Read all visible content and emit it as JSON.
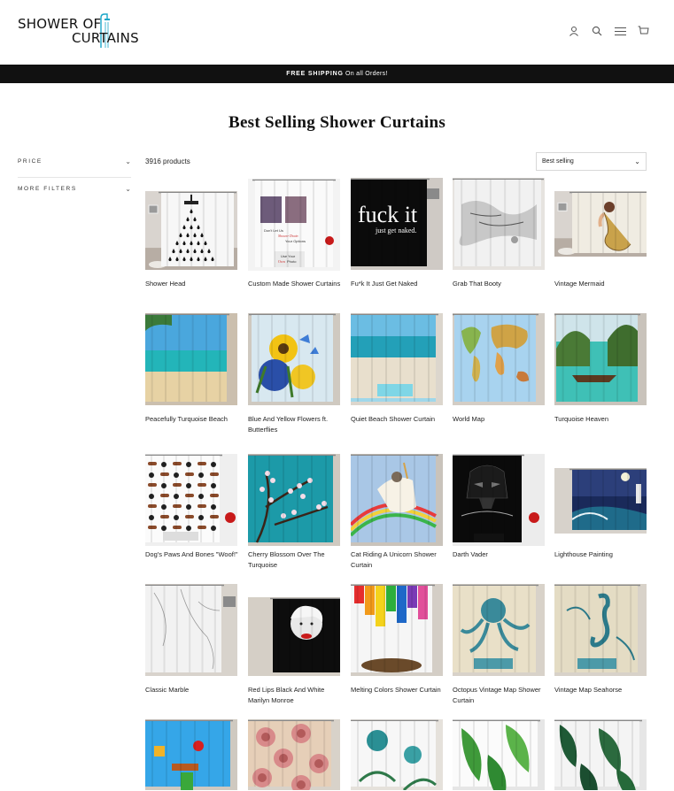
{
  "logo": {
    "line1": "SHOWER OF",
    "line2": "CURTAINS"
  },
  "header": {
    "icons": [
      "user-icon",
      "search-icon",
      "menu-icon",
      "cart-icon"
    ]
  },
  "announcement": {
    "bold": "FREE SHIPPING",
    "rest": " On all Orders!"
  },
  "page_title": "Best Selling Shower Curtains",
  "filters": [
    {
      "label": "PRICE"
    },
    {
      "label": "MORE FILTERS"
    }
  ],
  "product_count": "3916 products",
  "sort": {
    "selected": "Best selling"
  },
  "products": [
    {
      "title": "Shower Head"
    },
    {
      "title": "Custom Made Shower Curtains"
    },
    {
      "title": "Fu*k It Just Get Naked",
      "art_text1": "fuck it",
      "art_text2": "just get naked."
    },
    {
      "title": "Grab That Booty"
    },
    {
      "title": "Vintage Mermaid"
    },
    {
      "title": "Peacefully Turquoise Beach"
    },
    {
      "title": "Blue And Yellow Flowers ft. Butterflies"
    },
    {
      "title": "Quiet Beach Shower Curtain"
    },
    {
      "title": "World Map"
    },
    {
      "title": "Turquoise Heaven"
    },
    {
      "title": "Dog's Paws And Bones \"Woof!\""
    },
    {
      "title": "Cherry Blossom Over The Turquoise"
    },
    {
      "title": "Cat Riding A Unicorn Shower Curtain"
    },
    {
      "title": "Darth Vader"
    },
    {
      "title": "Lighthouse Painting"
    },
    {
      "title": "Classic Marble"
    },
    {
      "title": "Red Lips Black And White Marilyn Monroe"
    },
    {
      "title": "Melting Colors Shower Curtain"
    },
    {
      "title": "Octopus Vintage Map Shower Curtain"
    },
    {
      "title": "Vintage Map Seahorse"
    },
    {
      "title": ""
    },
    {
      "title": ""
    },
    {
      "title": ""
    },
    {
      "title": ""
    },
    {
      "title": ""
    }
  ],
  "custom_art": {
    "line1": "Don't Let Us",
    "line2": "Shower Drain",
    "line3": "Your Options",
    "line4": "Use Your",
    "line5": "Own",
    "line6": "Photo"
  },
  "colors": {
    "accent_teal": "#1aa6c8",
    "bar": "#111111"
  }
}
